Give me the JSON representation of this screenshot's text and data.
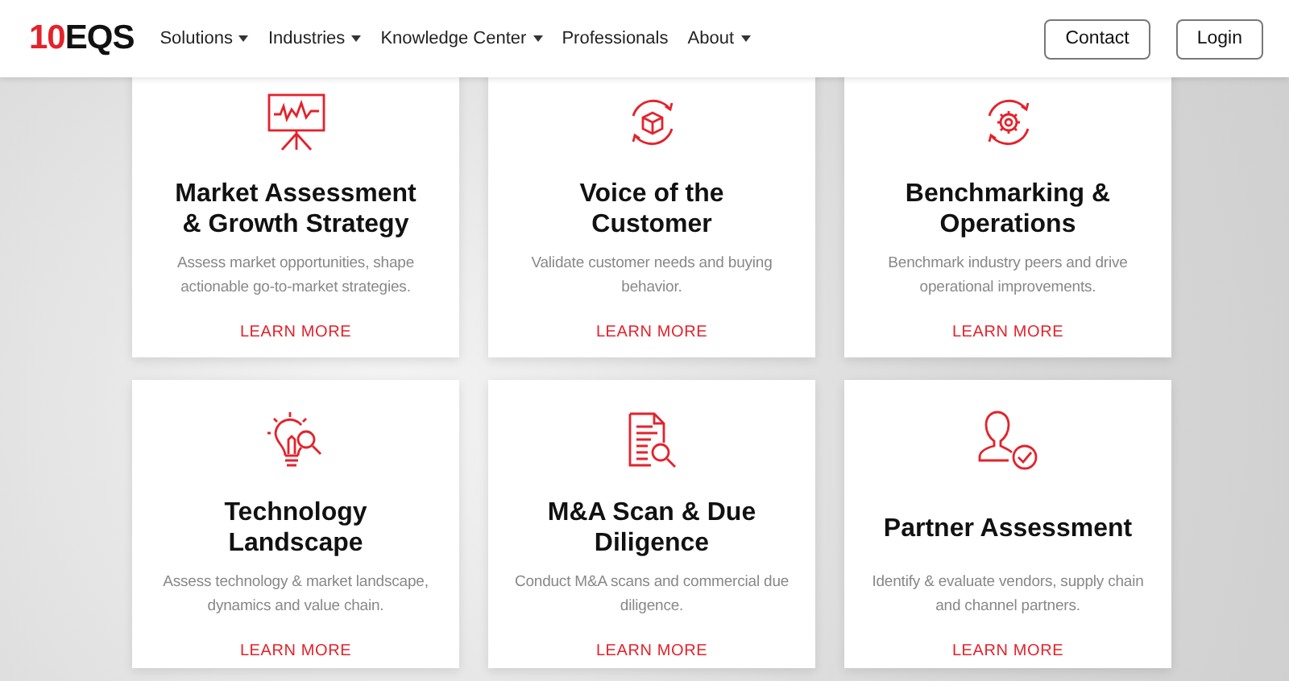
{
  "header": {
    "logo": {
      "accent": "10",
      "rest": "EQS"
    },
    "nav": [
      {
        "label": "Solutions",
        "dropdown": true
      },
      {
        "label": "Industries",
        "dropdown": true
      },
      {
        "label": "Knowledge Center",
        "dropdown": true
      },
      {
        "label": "Professionals",
        "dropdown": false
      },
      {
        "label": "About",
        "dropdown": true
      }
    ],
    "buttons": [
      "Contact",
      "Login"
    ]
  },
  "cards": [
    {
      "kind": "presentation",
      "title": "Market Assessment & Growth Strategy",
      "description": "Assess market opportunities, shape actionable go-to-market strategies.",
      "link": "LEARN MORE"
    },
    {
      "kind": "cycle-box",
      "title": "Voice of the Customer",
      "description": "Validate customer needs and buying behavior.",
      "link": "LEARN MORE"
    },
    {
      "kind": "cycle-gear",
      "title": "Benchmarking & Operations",
      "description": "Benchmark industry peers and drive operational improvements.",
      "link": "LEARN MORE"
    },
    {
      "kind": "bulb",
      "title": "Technology Landscape",
      "description": "Assess technology & market landscape, dynamics and value chain.",
      "link": "LEARN MORE"
    },
    {
      "kind": "document",
      "title": "M&A Scan & Due Diligence",
      "description": "Conduct M&A scans and commercial due diligence.",
      "link": "LEARN MORE"
    },
    {
      "kind": "person",
      "title": "Partner Assessment",
      "description": "Identify & evaluate vendors, supply chain and channel partners.",
      "link": "LEARN MORE"
    }
  ]
}
